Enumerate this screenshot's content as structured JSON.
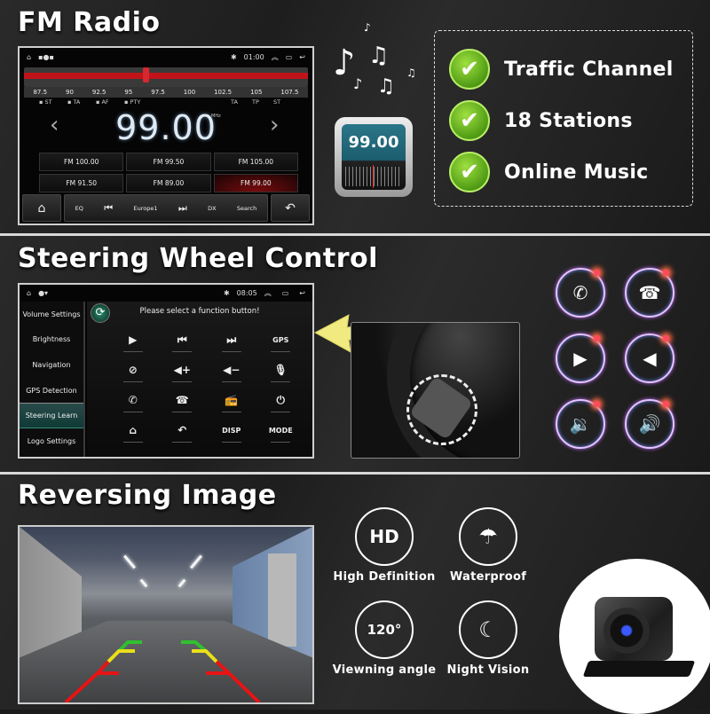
{
  "sections": {
    "fm_radio": {
      "title": "FM Radio",
      "screen": {
        "status": {
          "icons": [
            "home-outline-icon",
            "notification-icons"
          ],
          "bluetooth": "✱",
          "time": "01:00"
        },
        "dial_ticks": [
          "87.5",
          "90",
          "92.5",
          "95",
          "97.5",
          "100",
          "102.5",
          "105",
          "107.5"
        ],
        "rds_left": [
          "ST",
          "TA",
          "AF",
          "PTY"
        ],
        "rds_right": [
          "TA",
          "TP",
          "ST"
        ],
        "frequency": "99.00",
        "unit": "MHz",
        "presets": [
          {
            "label": "FM  100.00",
            "active": false
          },
          {
            "label": "FM  99.50",
            "active": false
          },
          {
            "label": "FM  105.00",
            "active": false
          },
          {
            "label": "FM  91.50",
            "active": false
          },
          {
            "label": "FM  89.00",
            "active": false
          },
          {
            "label": "FM  99.00",
            "active": true
          }
        ],
        "controls": [
          "EQ",
          "Europe1",
          "DX",
          "Search"
        ],
        "tuner_position": 0.42
      },
      "radio_icon_value": "99.00",
      "features": [
        "Traffic Channel",
        "18 Stations",
        "Online Music"
      ]
    },
    "steering": {
      "title": "Steering Wheel Control",
      "screen": {
        "time": "08:05",
        "sidebar": [
          "Volume Settings",
          "Brightness",
          "Navigation",
          "GPS Detection",
          "Steering Learn",
          "Logo Settings"
        ],
        "active_item": "Steering Learn",
        "prompt": "Please select a function button!",
        "functions": [
          {
            "glyph": "▶",
            "name": "play"
          },
          {
            "glyph": "⏮",
            "name": "previous"
          },
          {
            "glyph": "⏭",
            "name": "next"
          },
          {
            "glyph": "GPS",
            "name": "gps"
          },
          {
            "glyph": "⊘",
            "name": "mute"
          },
          {
            "glyph": "◀+",
            "name": "volume-up"
          },
          {
            "glyph": "◀−",
            "name": "volume-down"
          },
          {
            "glyph": "🎙",
            "name": "voice"
          },
          {
            "glyph": "✆",
            "name": "call"
          },
          {
            "glyph": "☎",
            "name": "hang-up"
          },
          {
            "glyph": "📻",
            "name": "radio"
          },
          {
            "glyph": "⏻",
            "name": "power"
          },
          {
            "glyph": "⌂",
            "name": "home"
          },
          {
            "glyph": "↶",
            "name": "back"
          },
          {
            "glyph": "DISP",
            "name": "display"
          },
          {
            "glyph": "MODE",
            "name": "mode"
          }
        ]
      },
      "round_icons": [
        {
          "glyph": "✆",
          "name": "call"
        },
        {
          "glyph": "☎",
          "name": "hang-up"
        },
        {
          "glyph": "▶",
          "name": "play"
        },
        {
          "glyph": "◀",
          "name": "previous"
        },
        {
          "glyph": "🔉",
          "name": "volume-down"
        },
        {
          "glyph": "🔊",
          "name": "volume-up"
        }
      ]
    },
    "reversing": {
      "title": "Reversing Image",
      "features": [
        {
          "icon": "HD",
          "label": "High Definition",
          "name": "hd"
        },
        {
          "icon": "☂",
          "label": "Waterproof",
          "name": "waterproof"
        },
        {
          "icon": "120°",
          "label": "Viewning angle",
          "name": "viewing-angle"
        },
        {
          "icon": "☾",
          "label": "Night Vision",
          "name": "night-vision"
        }
      ]
    }
  },
  "colors": {
    "accent_green": "#5aa81c",
    "radio_red": "#c0141a",
    "teal": "#1b5d6e"
  }
}
